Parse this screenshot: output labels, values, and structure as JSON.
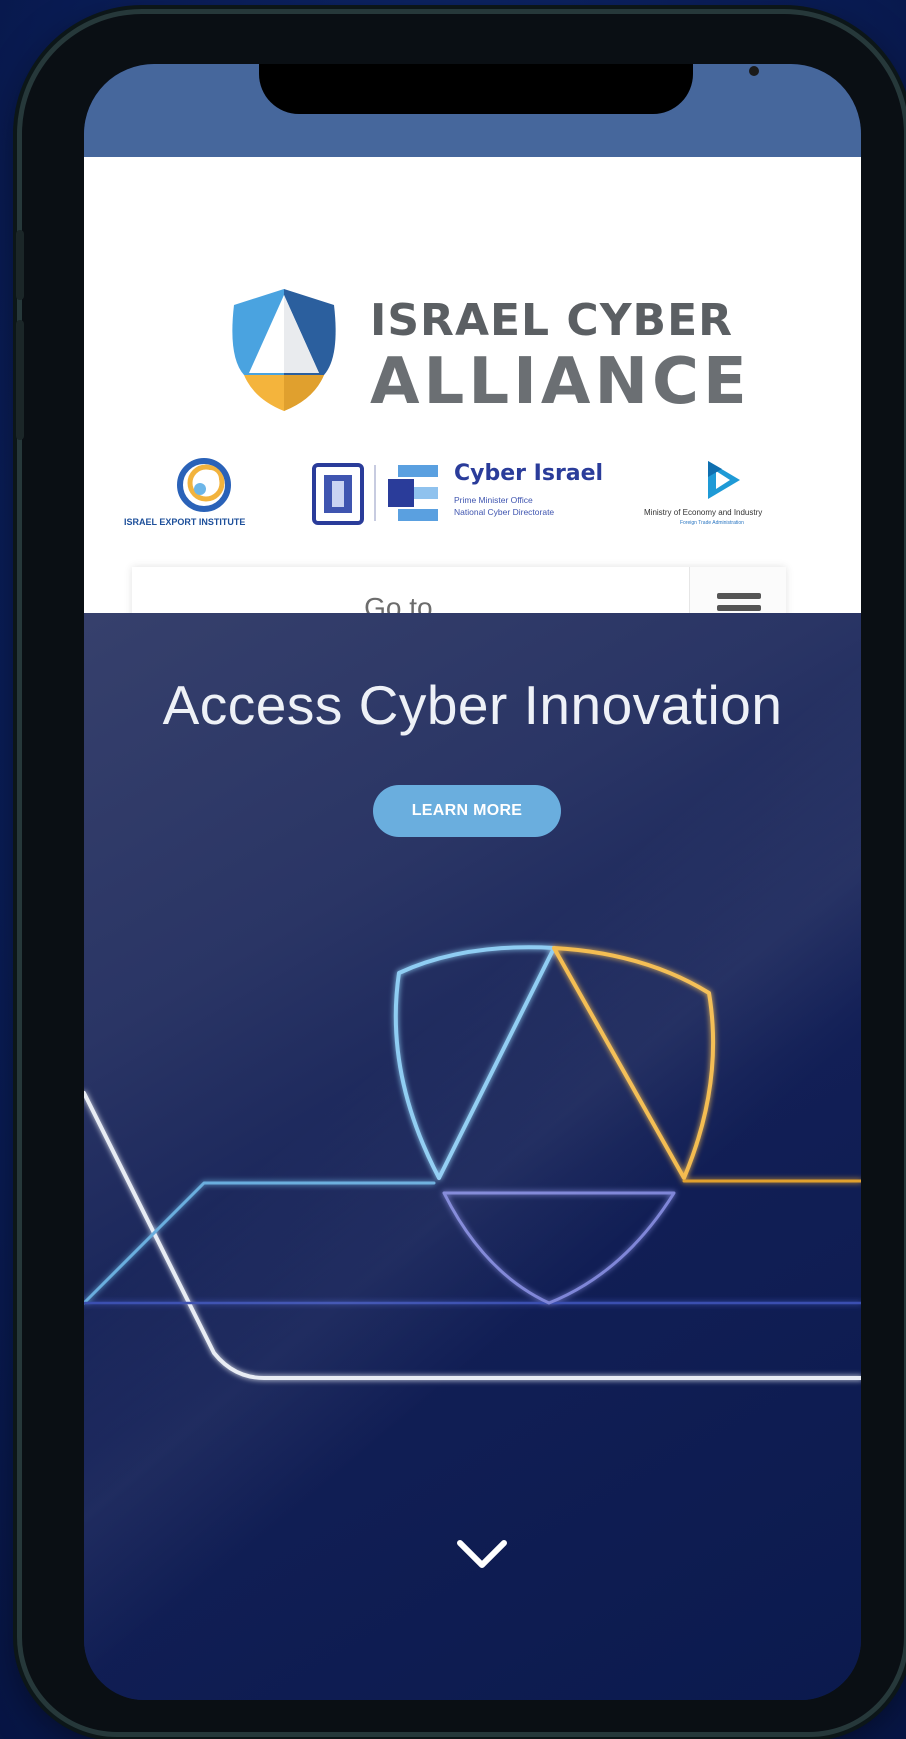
{
  "header": {
    "brand_line1": "ISRAEL CYBER",
    "brand_line2": "ALLIANCE",
    "logo_icon": "shield-logo-icon"
  },
  "partners": {
    "export_institute": "ISRAEL EXPORT INSTITUTE",
    "cyber_israel_title": "Cyber Israel",
    "cyber_israel_sub1": "Prime Minister Office",
    "cyber_israel_sub2": "National Cyber Directorate",
    "ministry": "Ministry of Economy and Industry",
    "ministry_sub": "Foreign Trade Administration"
  },
  "nav": {
    "goto_label": "Go to...",
    "menu_icon": "hamburger-menu-icon"
  },
  "hero": {
    "title": "Access Cyber Innovation",
    "button_label": "LEARN MORE",
    "scroll_icon": "chevron-down-icon"
  },
  "colors": {
    "status_bar": "#46679c",
    "hero_bg": "#121f56",
    "button": "#6aaede",
    "accent_blue": "#7fc4f0",
    "accent_gold": "#f0b94a"
  }
}
